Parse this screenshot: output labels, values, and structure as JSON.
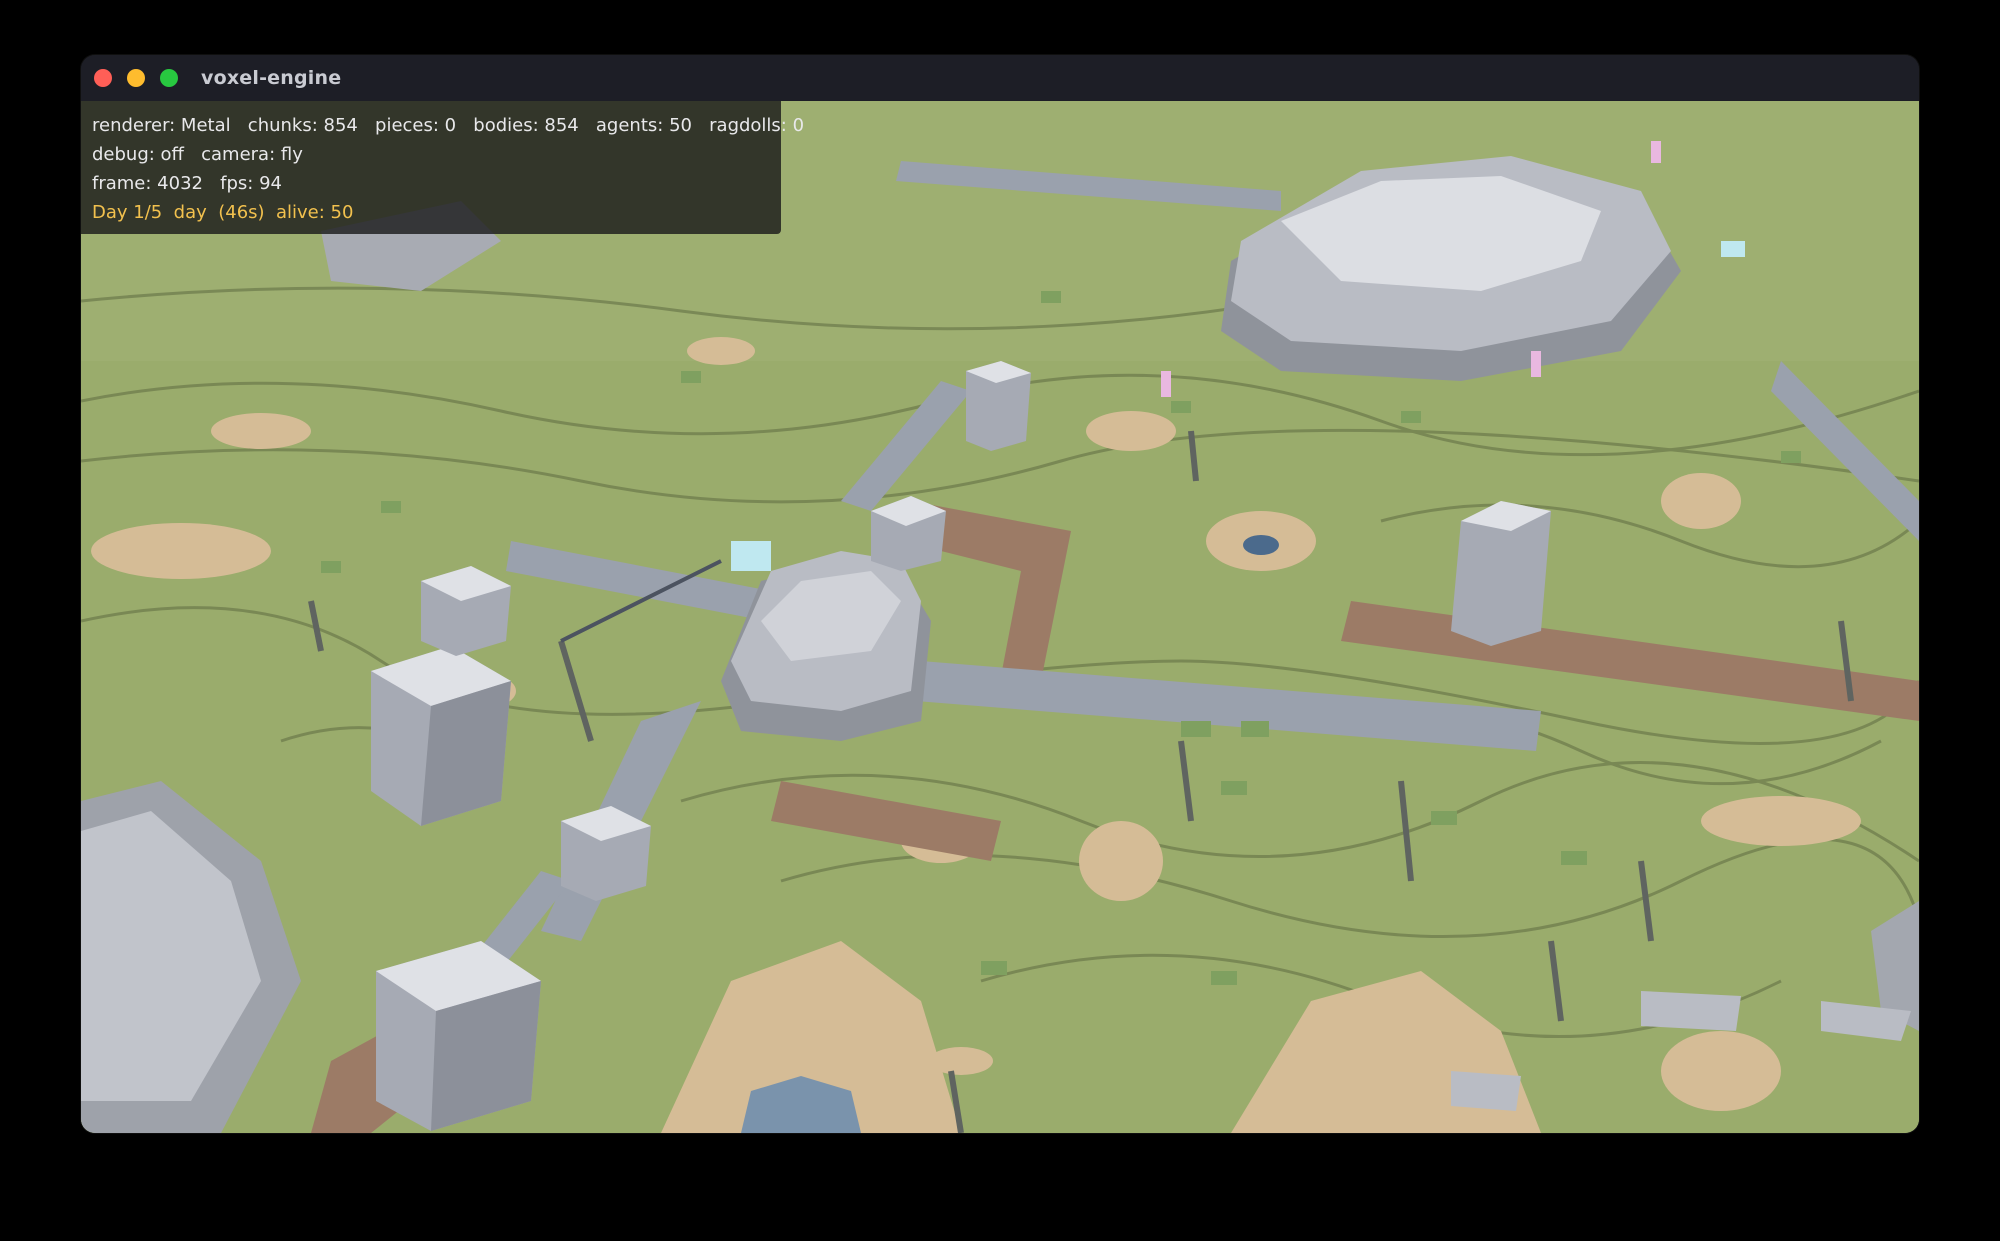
{
  "window": {
    "title": "voxel-engine"
  },
  "hud": {
    "line1": "renderer: Metal   chunks: 854   pieces: 0   bodies: 854   agents: 50   ragdolls: 0",
    "line2": "debug: off   camera: fly",
    "line3": "frame: 4032   fps: 94",
    "line4": "Day 1/5  day  (46s)  alive: 50"
  },
  "colors": {
    "grass": "#9aac6c",
    "sand": "#d5bc96",
    "dirt": "#9c7b66",
    "road": "#9aa1ad",
    "rock": "#b9bcc4",
    "building": "#b7bac4",
    "water": "#7a93ac",
    "status_text": "#f2c14e",
    "window_close": "#ff5f57",
    "window_minimize": "#febc2e",
    "window_maximize": "#28c840"
  },
  "icons": {
    "close": "close-dot-icon",
    "minimize": "minimize-dot-icon",
    "maximize": "maximize-dot-icon"
  }
}
